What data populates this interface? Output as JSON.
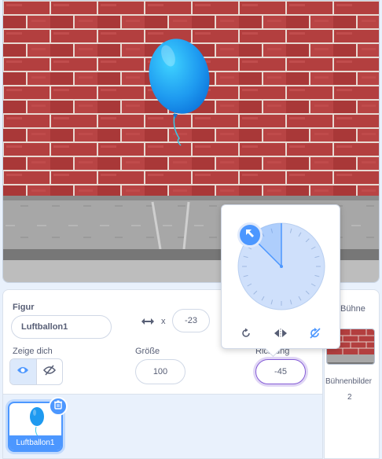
{
  "sprite_info": {
    "figure_label": "Figur",
    "sprite_name": "Luftballon1",
    "x_label": "x",
    "x_value": "-23",
    "show_label": "Zeige dich",
    "size_label": "Größe",
    "size_value": "100",
    "direction_label": "Richtung",
    "direction_value": "-45"
  },
  "sprite_list": [
    {
      "name": "Luftballon1",
      "selected": true
    }
  ],
  "stage_pane": {
    "title": "Bühne",
    "backdrops_label": "Bühnenbilder",
    "backdrops_count": "2"
  },
  "direction_popover": {
    "direction_degrees": -45,
    "buttons": [
      "rotate-around-icon",
      "left-right-icon",
      "dont-rotate-icon"
    ]
  },
  "colors": {
    "accent": "#4c97ff",
    "brick": "#b33f3f",
    "text": "#575e75"
  }
}
